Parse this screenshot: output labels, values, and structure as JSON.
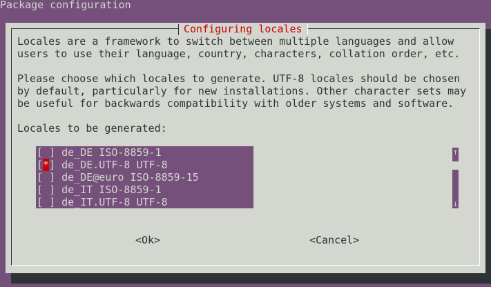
{
  "screen": {
    "title": "Package configuration"
  },
  "dialog": {
    "title": "Configuring locales",
    "description_lines": [
      "Locales are a framework to switch between multiple languages and allow",
      "users to use their language, country, characters, collation order, etc.",
      "",
      "Please choose which locales to generate. UTF-8 locales should be chosen",
      "by default, particularly for new installations. Other character sets may",
      "be useful for backwards compatibility with older systems and software.",
      "",
      "Locales to be generated:"
    ],
    "locales": [
      {
        "checked": false,
        "label": "de_DE ISO-8859-1"
      },
      {
        "checked": true,
        "label": "de_DE.UTF-8 UTF-8"
      },
      {
        "checked": false,
        "label": "de_DE@euro ISO-8859-15"
      },
      {
        "checked": false,
        "label": "de_IT ISO-8859-1"
      },
      {
        "checked": false,
        "label": "de_IT.UTF-8 UTF-8"
      }
    ],
    "scroll": {
      "up_icon": "↑",
      "down_icon": "↓",
      "position": 0.1
    },
    "buttons": {
      "ok": "<Ok>",
      "cancel": "<Cancel>"
    }
  },
  "colors": {
    "background": "#75507b",
    "dialog": "#d3d7cf",
    "title": "#cc0000",
    "text": "#2e3436",
    "list": "#75507b",
    "check_mark": "#cc0000"
  }
}
